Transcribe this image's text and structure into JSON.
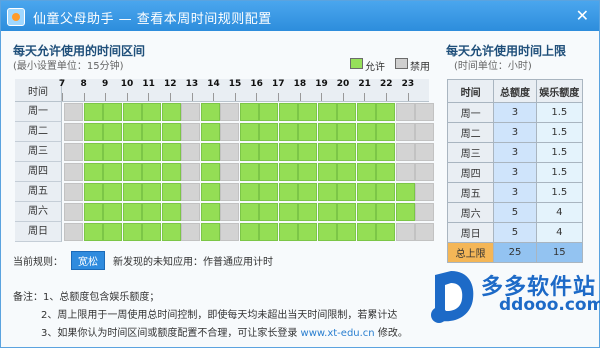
{
  "window": {
    "title": "仙童父母助手 — 查看本周时间规则配置",
    "close": "✕"
  },
  "schedule": {
    "title": "每天允许使用的时间区间",
    "subtitle": "(最小设置单位：15分钟)",
    "legend_allow": "允许",
    "legend_forbid": "禁用",
    "time_header": "时间",
    "hours": [
      "7",
      "8",
      "9",
      "10",
      "11",
      "12",
      "13",
      "14",
      "15",
      "16",
      "17",
      "18",
      "19",
      "20",
      "21",
      "22",
      "23"
    ],
    "days": [
      {
        "label": "周一",
        "forbidden": [
          0,
          6,
          8,
          17,
          18
        ]
      },
      {
        "label": "周二",
        "forbidden": [
          0,
          6,
          8,
          17,
          18
        ]
      },
      {
        "label": "周三",
        "forbidden": [
          0,
          6,
          8,
          17,
          18
        ]
      },
      {
        "label": "周四",
        "forbidden": [
          0,
          6,
          8,
          17,
          18
        ]
      },
      {
        "label": "周五",
        "forbidden": [
          0,
          6,
          8,
          18
        ]
      },
      {
        "label": "周六",
        "forbidden": [
          0,
          6,
          8,
          18
        ]
      },
      {
        "label": "周日",
        "forbidden": [
          0,
          6,
          8,
          17,
          18
        ]
      }
    ],
    "columns": 19
  },
  "rule": {
    "label": "当前规则：",
    "badge": "宽松",
    "text": "新发现的未知应用：作普通应用计时"
  },
  "notes": {
    "line1": "备注：1、总额度包含娱乐额度；",
    "line2": "2、周上限用于一周使用总时间控制，即使每天均未超出当天时间限制，若累计达",
    "line3_pre": "3、如果你认为时间区间或额度配置不合理，可让家长登录 ",
    "line3_link": "www.xt-edu.cn",
    "line3_post": " 修改。"
  },
  "limits": {
    "title": "每天允许使用时间上限",
    "subtitle": "(时间单位：小时)",
    "headers": [
      "时间",
      "总额度",
      "娱乐额度"
    ],
    "rows": [
      {
        "day": "周一",
        "total": "3",
        "ent": "1.5"
      },
      {
        "day": "周二",
        "total": "3",
        "ent": "1.5"
      },
      {
        "day": "周三",
        "total": "3",
        "ent": "1.5"
      },
      {
        "day": "周四",
        "total": "3",
        "ent": "1.5"
      },
      {
        "day": "周五",
        "total": "3",
        "ent": "1.5"
      },
      {
        "day": "周六",
        "total": "5",
        "ent": "4"
      },
      {
        "day": "周日",
        "total": "5",
        "ent": "4"
      }
    ],
    "sum": {
      "day": "总上限",
      "total": "25",
      "ent": "15"
    }
  },
  "watermark": {
    "cn": "多多软件站",
    "url": "ddooo.com"
  }
}
